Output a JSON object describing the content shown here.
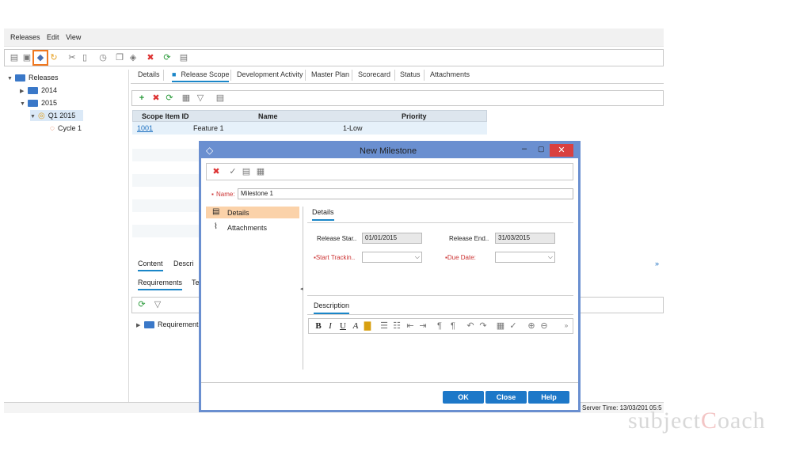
{
  "menu": [
    "Releases",
    "Edit",
    "View"
  ],
  "toolbar_icons": [
    "release-folder-icon",
    "cycle-icon",
    "new-milestone-icon",
    "refresh-cycle-icon",
    "cut-icon",
    "paste-icon",
    "clock-icon",
    "copy-icon",
    "tag-icon",
    "delete-icon",
    "refresh-icon",
    "notes-icon"
  ],
  "tree": {
    "root": "Releases",
    "y2014": "2014",
    "y2015": "2015",
    "q1": "Q1 2015",
    "cycle": "Cycle 1"
  },
  "tabs": [
    "Details",
    "Release Scope",
    "Development Activity",
    "Master Plan",
    "Scorecard",
    "Status",
    "Attachments"
  ],
  "grid": {
    "headers": [
      "Scope Item ID",
      "Name",
      "Priority"
    ],
    "row": {
      "id": "1001",
      "name": "Feature 1",
      "priority": "1-Low"
    }
  },
  "bottom": {
    "tabs": [
      "Content",
      "Descri"
    ],
    "subtabs": [
      "Requirements",
      "Te"
    ],
    "tree_item": "Requirements"
  },
  "status": {
    "server_time": "Server Time: 13/03/201",
    "clock": "05:5"
  },
  "dialog": {
    "title": "New Milestone",
    "name_label": "Name:",
    "name_value": "Milestone 1",
    "nav": [
      "Details",
      "Attachments"
    ],
    "details_tab": "Details",
    "release_start_label": "Release Star..",
    "release_start_value": "01/01/2015",
    "release_end_label": "Release End..",
    "release_end_value": "31/03/2015",
    "start_tracking_label": "Start Trackin..",
    "due_date_label": "Due Date:",
    "description_tab": "Description",
    "buttons": {
      "ok": "OK",
      "close": "Close",
      "help": "Help"
    }
  },
  "watermark": {
    "pre": "subject",
    "c": "C",
    "post": "oach"
  }
}
